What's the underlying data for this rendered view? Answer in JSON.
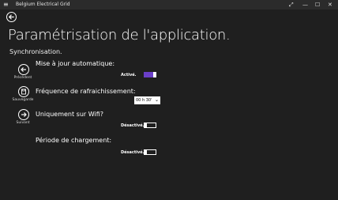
{
  "window": {
    "title": "Belgium Electrical Grid",
    "menu_icon": "≡",
    "controls": {
      "fullscreen_icon": "⤢",
      "minimize_icon": "—",
      "maximize_icon": "☐",
      "close_icon": "✕"
    }
  },
  "page": {
    "title": "Paramétrisation de l'application.",
    "section": "Synchronisation."
  },
  "nav": {
    "previous_label": "Précédent",
    "save_label": "Sauvegarde",
    "next_label": "Suivant"
  },
  "settings": {
    "auto_update": {
      "label": "Mise à jour automatique:",
      "state": "Activé.",
      "on": true
    },
    "refresh_rate": {
      "label": "Fréquence de rafraichissement:",
      "value": "00 h 30'"
    },
    "wifi_only": {
      "label": "Uniquement sur Wifi?",
      "state": "Désactivé.",
      "on": false
    },
    "charge_period": {
      "label": "Période de chargement:",
      "state": "Désactivé.",
      "on": false
    }
  },
  "colors": {
    "accent": "#6a3fc8",
    "background": "#1f1f1f",
    "titlebar": "#2b2b2b"
  },
  "icons": [
    "menu-icon",
    "back-arrow-icon",
    "previous-arrow-icon",
    "save-disk-icon",
    "next-arrow-icon",
    "chevron-down-icon"
  ]
}
